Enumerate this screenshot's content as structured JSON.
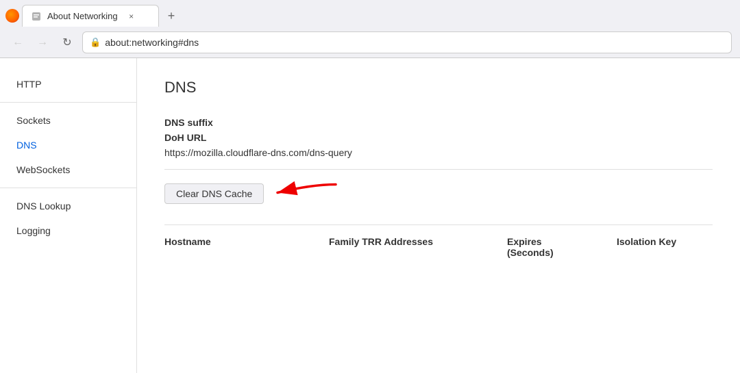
{
  "browser": {
    "tab": {
      "title": "About Networking",
      "close_label": "×",
      "new_tab_label": "+"
    },
    "address": {
      "url": "about:networking#dns",
      "back_label": "←",
      "forward_label": "→",
      "reload_label": "↻"
    }
  },
  "sidebar": {
    "items": [
      {
        "id": "http",
        "label": "HTTP",
        "active": false
      },
      {
        "id": "sockets",
        "label": "Sockets",
        "active": false
      },
      {
        "id": "dns",
        "label": "DNS",
        "active": true
      },
      {
        "id": "websockets",
        "label": "WebSockets",
        "active": false
      },
      {
        "id": "dns-lookup",
        "label": "DNS Lookup",
        "active": false
      },
      {
        "id": "logging",
        "label": "Logging",
        "active": false
      }
    ]
  },
  "content": {
    "page_title": "DNS",
    "dns_suffix_label": "DNS suffix",
    "doh_url_label": "DoH URL",
    "doh_url_value": "https://mozilla.cloudflare-dns.com/dns-query",
    "clear_btn_label": "Clear DNS Cache",
    "table_headers": {
      "hostname": "Hostname",
      "family_trr": "Family TRR Addresses",
      "expires": "Expires\n(Seconds)",
      "isolation_key": "Isolation Key"
    }
  }
}
